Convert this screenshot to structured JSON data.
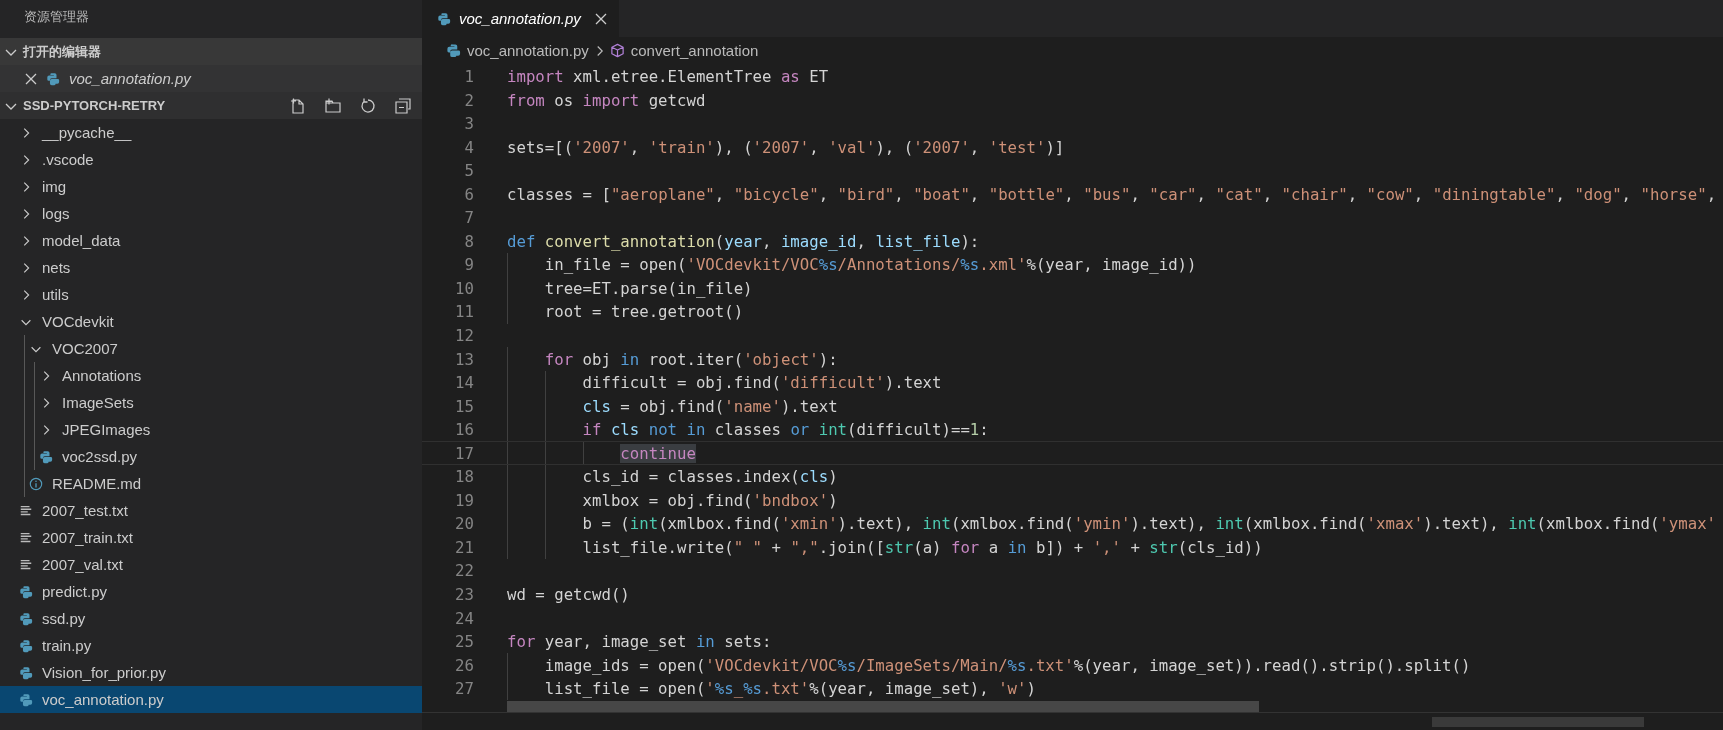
{
  "sidebar": {
    "title": "资源管理器",
    "open_editors": {
      "title": "打开的编辑器",
      "expanded": true,
      "items": [
        {
          "name": "voc_annotation.py",
          "kind": "python",
          "preview": true
        }
      ]
    },
    "project": {
      "title": "SSD-PYTORCH-RETRY",
      "expanded": true,
      "tree": [
        {
          "name": "__pycache__",
          "kind": "folder",
          "expanded": false,
          "selected": false
        },
        {
          "name": ".vscode",
          "kind": "folder",
          "expanded": false,
          "selected": false
        },
        {
          "name": "img",
          "kind": "folder",
          "expanded": false,
          "selected": false
        },
        {
          "name": "logs",
          "kind": "folder",
          "expanded": false,
          "selected": false
        },
        {
          "name": "model_data",
          "kind": "folder",
          "expanded": false,
          "selected": false
        },
        {
          "name": "nets",
          "kind": "folder",
          "expanded": false,
          "selected": false
        },
        {
          "name": "utils",
          "kind": "folder",
          "expanded": false,
          "selected": false
        },
        {
          "name": "VOCdevkit",
          "kind": "folder",
          "expanded": true,
          "selected": false,
          "children": [
            {
              "name": "VOC2007",
              "kind": "folder",
              "expanded": true,
              "selected": false,
              "children": [
                {
                  "name": "Annotations",
                  "kind": "folder",
                  "expanded": false,
                  "selected": false
                },
                {
                  "name": "ImageSets",
                  "kind": "folder",
                  "expanded": false,
                  "selected": false
                },
                {
                  "name": "JPEGImages",
                  "kind": "folder",
                  "expanded": false,
                  "selected": false
                },
                {
                  "name": "voc2ssd.py",
                  "kind": "python",
                  "selected": false
                }
              ]
            },
            {
              "name": "README.md",
              "kind": "info",
              "selected": false
            }
          ]
        },
        {
          "name": "2007_test.txt",
          "kind": "text",
          "selected": false
        },
        {
          "name": "2007_train.txt",
          "kind": "text",
          "selected": false
        },
        {
          "name": "2007_val.txt",
          "kind": "text",
          "selected": false
        },
        {
          "name": "predict.py",
          "kind": "python",
          "selected": false
        },
        {
          "name": "ssd.py",
          "kind": "python",
          "selected": false
        },
        {
          "name": "train.py",
          "kind": "python",
          "selected": false
        },
        {
          "name": "Vision_for_prior.py",
          "kind": "python",
          "selected": false
        },
        {
          "name": "voc_annotation.py",
          "kind": "python",
          "selected": true
        }
      ]
    }
  },
  "editor": {
    "tabs": [
      {
        "label": "voc_annotation.py",
        "kind": "python",
        "selected": true,
        "preview": true
      }
    ],
    "breadcrumb": [
      {
        "label": "voc_annotation.py",
        "kind": "python"
      },
      {
        "label": "convert_annotation",
        "kind": "function"
      }
    ],
    "lines": [
      {
        "number": "1",
        "current": false,
        "tokens": [
          {
            "text": "import",
            "kind": "keyword"
          },
          {
            "text": " xml.etree.ElementTree ",
            "kind": "plain"
          },
          {
            "text": "as",
            "kind": "keyword"
          },
          {
            "text": " ET",
            "kind": "plain"
          }
        ]
      },
      {
        "number": "2",
        "current": false,
        "tokens": [
          {
            "text": "from",
            "kind": "keyword"
          },
          {
            "text": " os ",
            "kind": "plain"
          },
          {
            "text": "import",
            "kind": "keyword"
          },
          {
            "text": " getcwd",
            "kind": "plain"
          }
        ]
      },
      {
        "number": "3",
        "current": false
      },
      {
        "number": "4",
        "current": false,
        "tokens": [
          {
            "text": "sets=[(",
            "kind": "plain"
          },
          {
            "text": "'2007'",
            "kind": "string"
          },
          {
            "text": ", ",
            "kind": "plain"
          },
          {
            "text": "'train'",
            "kind": "string"
          },
          {
            "text": "), (",
            "kind": "plain"
          },
          {
            "text": "'2007'",
            "kind": "string"
          },
          {
            "text": ", ",
            "kind": "plain"
          },
          {
            "text": "'val'",
            "kind": "string"
          },
          {
            "text": "), (",
            "kind": "plain"
          },
          {
            "text": "'2007'",
            "kind": "string"
          },
          {
            "text": ", ",
            "kind": "plain"
          },
          {
            "text": "'test'",
            "kind": "string"
          },
          {
            "text": ")]",
            "kind": "plain"
          }
        ]
      },
      {
        "number": "5",
        "current": false
      },
      {
        "number": "6",
        "current": false,
        "tokens": [
          {
            "text": "classes = [",
            "kind": "plain"
          },
          {
            "text": "\"aeroplane\"",
            "kind": "string"
          },
          {
            "text": ", ",
            "kind": "plain"
          },
          {
            "text": "\"bicycle\"",
            "kind": "string"
          },
          {
            "text": ", ",
            "kind": "plain"
          },
          {
            "text": "\"bird\"",
            "kind": "string"
          },
          {
            "text": ", ",
            "kind": "plain"
          },
          {
            "text": "\"boat\"",
            "kind": "string"
          },
          {
            "text": ", ",
            "kind": "plain"
          },
          {
            "text": "\"bottle\"",
            "kind": "string"
          },
          {
            "text": ", ",
            "kind": "plain"
          },
          {
            "text": "\"bus\"",
            "kind": "string"
          },
          {
            "text": ", ",
            "kind": "plain"
          },
          {
            "text": "\"car\"",
            "kind": "string"
          },
          {
            "text": ", ",
            "kind": "plain"
          },
          {
            "text": "\"cat\"",
            "kind": "string"
          },
          {
            "text": ", ",
            "kind": "plain"
          },
          {
            "text": "\"chair\"",
            "kind": "string"
          },
          {
            "text": ", ",
            "kind": "plain"
          },
          {
            "text": "\"cow\"",
            "kind": "string"
          },
          {
            "text": ", ",
            "kind": "plain"
          },
          {
            "text": "\"diningtable\"",
            "kind": "string"
          },
          {
            "text": ", ",
            "kind": "plain"
          },
          {
            "text": "\"dog\"",
            "kind": "string"
          },
          {
            "text": ", ",
            "kind": "plain"
          },
          {
            "text": "\"horse\"",
            "kind": "string"
          },
          {
            "text": ",",
            "kind": "plain"
          }
        ]
      },
      {
        "number": "7",
        "current": false
      },
      {
        "number": "8",
        "current": false,
        "tokens": [
          {
            "text": "def ",
            "kind": "control"
          },
          {
            "text": "convert_annotation",
            "kind": "function"
          },
          {
            "text": "(",
            "kind": "plain"
          },
          {
            "text": "year",
            "kind": "variable"
          },
          {
            "text": ", ",
            "kind": "plain"
          },
          {
            "text": "image_id",
            "kind": "variable"
          },
          {
            "text": ", ",
            "kind": "plain"
          },
          {
            "text": "list_file",
            "kind": "variable"
          },
          {
            "text": "):",
            "kind": "plain"
          }
        ]
      },
      {
        "number": "9",
        "current": false,
        "tokens": [
          {
            "text": "    in_file = open(",
            "kind": "plain"
          },
          {
            "text": "'VOCdevkit/VOC",
            "kind": "string"
          },
          {
            "text": "%s",
            "kind": "escape"
          },
          {
            "text": "/Annotations/",
            "kind": "string"
          },
          {
            "text": "%s",
            "kind": "escape"
          },
          {
            "text": ".xml'",
            "kind": "string"
          },
          {
            "text": "%(year, image_id))",
            "kind": "plain"
          }
        ]
      },
      {
        "number": "10",
        "current": false,
        "tokens": [
          {
            "text": "    tree=ET.parse(in_file)",
            "kind": "plain"
          }
        ]
      },
      {
        "number": "11",
        "current": false,
        "tokens": [
          {
            "text": "    root = tree.getroot()",
            "kind": "plain"
          }
        ]
      },
      {
        "number": "12",
        "current": false
      },
      {
        "number": "13",
        "current": false,
        "tokens": [
          {
            "text": "    for",
            "kind": "keyword"
          },
          {
            "text": " obj ",
            "kind": "plain"
          },
          {
            "text": "in",
            "kind": "control"
          },
          {
            "text": " root.iter(",
            "kind": "plain"
          },
          {
            "text": "'object'",
            "kind": "string"
          },
          {
            "text": "):",
            "kind": "plain"
          }
        ]
      },
      {
        "number": "14",
        "current": false,
        "tokens": [
          {
            "text": "        difficult = obj.find(",
            "kind": "plain"
          },
          {
            "text": "'difficult'",
            "kind": "string"
          },
          {
            "text": ").text",
            "kind": "plain"
          }
        ]
      },
      {
        "number": "15",
        "current": false,
        "tokens": [
          {
            "text": "        cls",
            "kind": "variable"
          },
          {
            "text": " = obj.find(",
            "kind": "plain"
          },
          {
            "text": "'name'",
            "kind": "string"
          },
          {
            "text": ").text",
            "kind": "plain"
          }
        ]
      },
      {
        "number": "16",
        "current": false,
        "tokens": [
          {
            "text": "        if ",
            "kind": "keyword"
          },
          {
            "text": "cls ",
            "kind": "variable"
          },
          {
            "text": "not ",
            "kind": "control"
          },
          {
            "text": "in",
            "kind": "control"
          },
          {
            "text": " classes ",
            "kind": "plain"
          },
          {
            "text": "or ",
            "kind": "control"
          },
          {
            "text": "int",
            "kind": "builtin"
          },
          {
            "text": "(difficult)==",
            "kind": "plain"
          },
          {
            "text": "1",
            "kind": "number"
          },
          {
            "text": ":",
            "kind": "plain"
          }
        ]
      },
      {
        "number": "17",
        "current": true,
        "tokens": [
          {
            "text": "            continue",
            "kind": "highlight"
          }
        ]
      },
      {
        "number": "18",
        "current": false,
        "tokens": [
          {
            "text": "        cls_id = classes.index(",
            "kind": "plain"
          },
          {
            "text": "cls",
            "kind": "variable"
          },
          {
            "text": ")",
            "kind": "plain"
          }
        ]
      },
      {
        "number": "19",
        "current": false,
        "tokens": [
          {
            "text": "        xmlbox = obj.find(",
            "kind": "plain"
          },
          {
            "text": "'bndbox'",
            "kind": "string"
          },
          {
            "text": ")",
            "kind": "plain"
          }
        ]
      },
      {
        "number": "20",
        "current": false,
        "tokens": [
          {
            "text": "        b = (",
            "kind": "plain"
          },
          {
            "text": "int",
            "kind": "builtin"
          },
          {
            "text": "(xmlbox.find(",
            "kind": "plain"
          },
          {
            "text": "'xmin'",
            "kind": "string"
          },
          {
            "text": ").text), ",
            "kind": "plain"
          },
          {
            "text": "int",
            "kind": "builtin"
          },
          {
            "text": "(xmlbox.find(",
            "kind": "plain"
          },
          {
            "text": "'ymin'",
            "kind": "string"
          },
          {
            "text": ").text), ",
            "kind": "plain"
          },
          {
            "text": "int",
            "kind": "builtin"
          },
          {
            "text": "(xmlbox.find(",
            "kind": "plain"
          },
          {
            "text": "'xmax'",
            "kind": "string"
          },
          {
            "text": ").text), ",
            "kind": "plain"
          },
          {
            "text": "int",
            "kind": "builtin"
          },
          {
            "text": "(xmlbox.find(",
            "kind": "plain"
          },
          {
            "text": "'ymax'",
            "kind": "string"
          }
        ]
      },
      {
        "number": "21",
        "current": false,
        "tokens": [
          {
            "text": "        list_file.write(",
            "kind": "plain"
          },
          {
            "text": "\" \"",
            "kind": "string"
          },
          {
            "text": " + ",
            "kind": "plain"
          },
          {
            "text": "\",\"",
            "kind": "string"
          },
          {
            "text": ".join([",
            "kind": "plain"
          },
          {
            "text": "str",
            "kind": "builtin"
          },
          {
            "text": "(a) ",
            "kind": "plain"
          },
          {
            "text": "for",
            "kind": "keyword"
          },
          {
            "text": " a ",
            "kind": "plain"
          },
          {
            "text": "in",
            "kind": "control"
          },
          {
            "text": " b]) + ",
            "kind": "plain"
          },
          {
            "text": "','",
            "kind": "string"
          },
          {
            "text": " + ",
            "kind": "plain"
          },
          {
            "text": "str",
            "kind": "builtin"
          },
          {
            "text": "(cls_id))",
            "kind": "plain"
          }
        ]
      },
      {
        "number": "22",
        "current": false
      },
      {
        "number": "23",
        "current": false,
        "tokens": [
          {
            "text": "wd = getcwd()",
            "kind": "plain"
          }
        ]
      },
      {
        "number": "24",
        "current": false
      },
      {
        "number": "25",
        "current": false,
        "tokens": [
          {
            "text": "for",
            "kind": "keyword"
          },
          {
            "text": " year, image_set ",
            "kind": "plain"
          },
          {
            "text": "in",
            "kind": "control"
          },
          {
            "text": " sets:",
            "kind": "plain"
          }
        ]
      },
      {
        "number": "26",
        "current": false,
        "tokens": [
          {
            "text": "    image_ids = open(",
            "kind": "plain"
          },
          {
            "text": "'VOCdevkit/VOC",
            "kind": "string"
          },
          {
            "text": "%s",
            "kind": "escape"
          },
          {
            "text": "/ImageSets/Main/",
            "kind": "string"
          },
          {
            "text": "%s",
            "kind": "escape"
          },
          {
            "text": ".txt'",
            "kind": "string"
          },
          {
            "text": "%(year, image_set)).read().strip().split()",
            "kind": "plain"
          }
        ]
      },
      {
        "number": "27",
        "current": false,
        "tokens": [
          {
            "text": "    list_file = open(",
            "kind": "plain"
          },
          {
            "text": "'",
            "kind": "string"
          },
          {
            "text": "%s",
            "kind": "escape"
          },
          {
            "text": "_",
            "kind": "string"
          },
          {
            "text": "%s",
            "kind": "escape"
          },
          {
            "text": ".txt'",
            "kind": "string"
          },
          {
            "text": "%(year, image_set), ",
            "kind": "plain"
          },
          {
            "text": "'w'",
            "kind": "string"
          },
          {
            "text": ")",
            "kind": "plain"
          }
        ]
      }
    ]
  }
}
